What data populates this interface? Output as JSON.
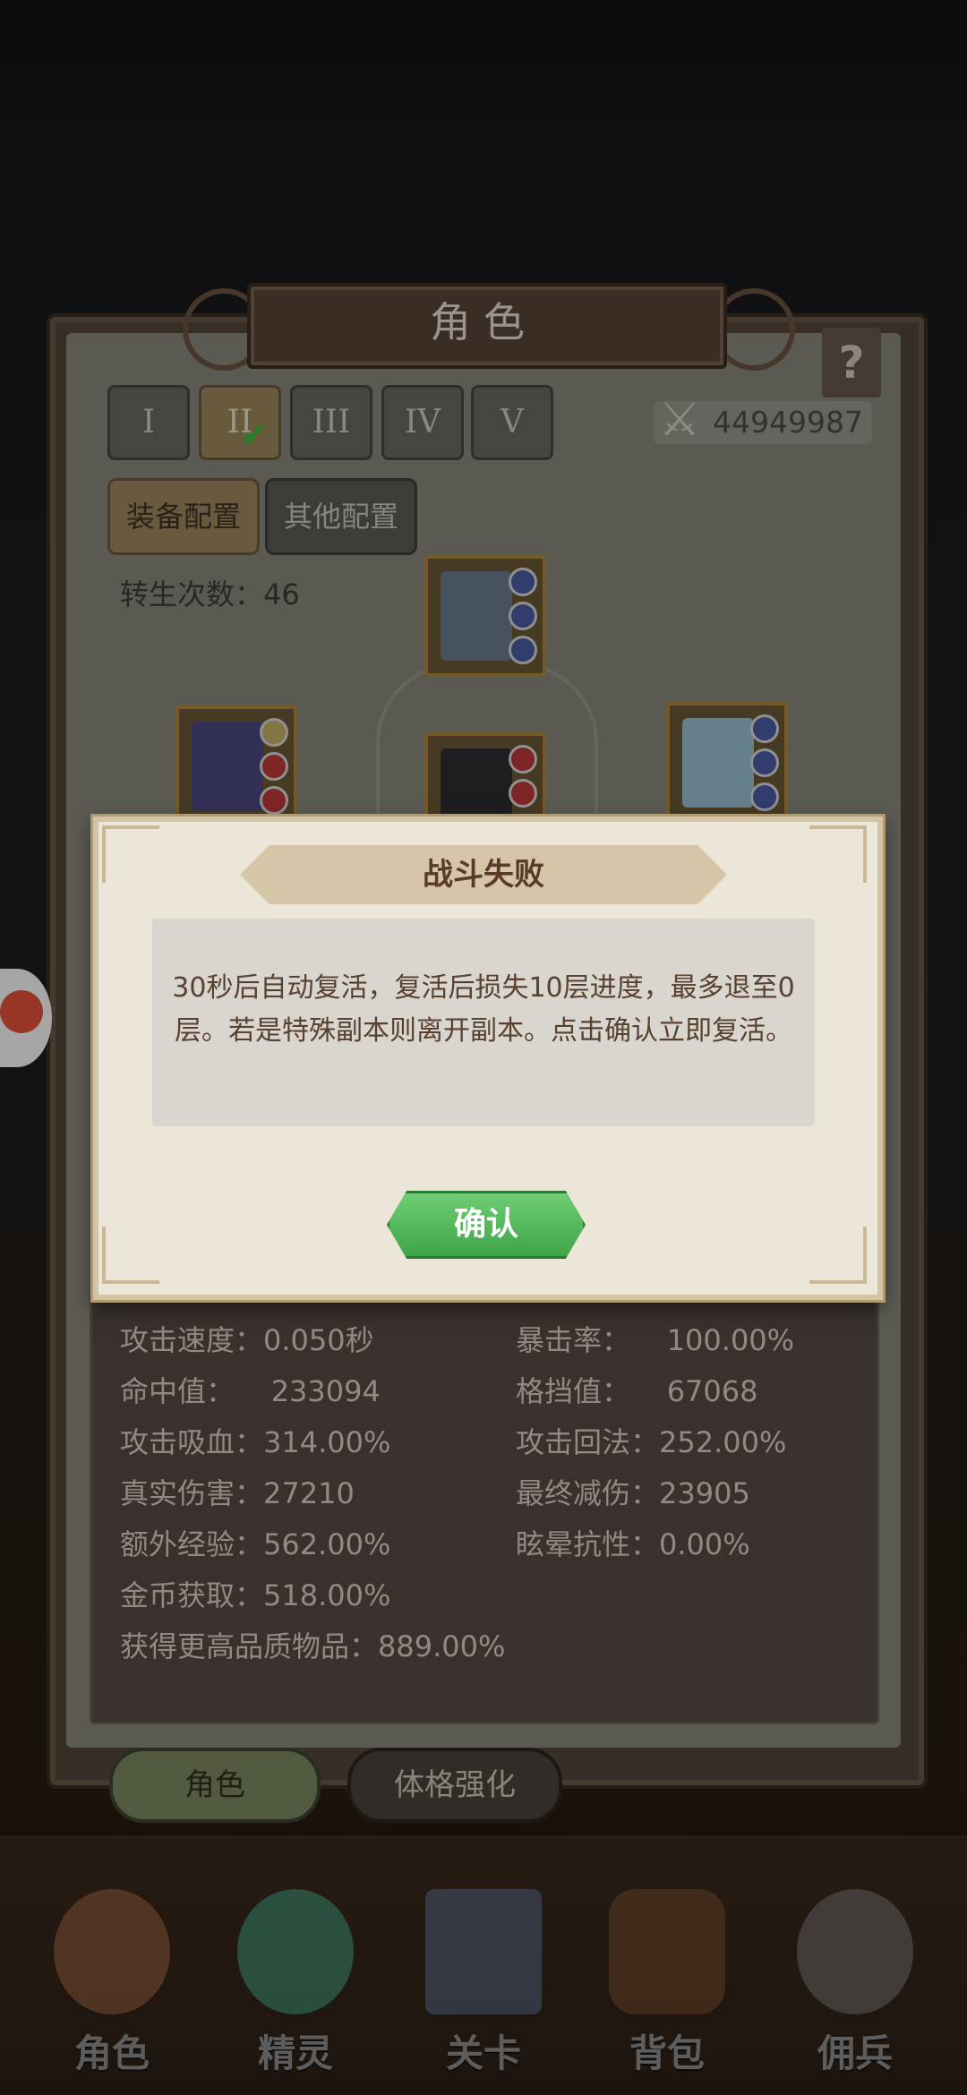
{
  "title": "角色",
  "help_label": "?",
  "tiers": [
    "I",
    "II",
    "III",
    "IV",
    "V"
  ],
  "active_tier": "II",
  "power": {
    "value": "44949987",
    "icon": "crossed-swords-icon"
  },
  "config_buttons": {
    "equip": "装备配置",
    "other": "其他配置"
  },
  "rebirth": {
    "label": "转生次数：46"
  },
  "stats": [
    {
      "label": "攻击速度：0.050秒",
      "col": 0
    },
    {
      "label": "暴击率：    100.00%",
      "col": 1
    },
    {
      "label": "命中值：    233094",
      "col": 0
    },
    {
      "label": "格挡值：    67068",
      "col": 1
    },
    {
      "label": "攻击吸血：314.00%",
      "col": 0
    },
    {
      "label": "攻击回法：252.00%",
      "col": 1
    },
    {
      "label": "真实伤害：27210",
      "col": 0
    },
    {
      "label": "最终减伤：23905",
      "col": 1
    },
    {
      "label": "额外经验：562.00%",
      "col": 0
    },
    {
      "label": "眩晕抗性：0.00%",
      "col": 1
    },
    {
      "label": "金币获取：518.00%",
      "col": 0
    },
    {
      "label": "获得更高品质物品：889.00%",
      "col": 0
    }
  ],
  "bottom_tabs": {
    "role": "角色",
    "body": "体格强化"
  },
  "nav": [
    {
      "label": "角色",
      "icon": "hero-portrait-icon",
      "color": "#b9744c"
    },
    {
      "label": "精灵",
      "icon": "sprite-slime-icon",
      "color": "#4fbf9a"
    },
    {
      "label": "关卡",
      "icon": "stage-gate-icon",
      "color": "#6b7fa8"
    },
    {
      "label": "背包",
      "icon": "backpack-icon",
      "color": "#8a5a34"
    },
    {
      "label": "佣兵",
      "icon": "knight-helmet-icon",
      "color": "#8b8b8b"
    }
  ],
  "dialog": {
    "title": "战斗失败",
    "message": "30秒后自动复活，复活后损失10层进度，最多退至0层。若是特殊副本则离开副本。点击确认立即复活。",
    "confirm_label": "确认"
  },
  "colors": {
    "accent_green": "#3fa548",
    "gold_frame": "#b48a3d"
  }
}
